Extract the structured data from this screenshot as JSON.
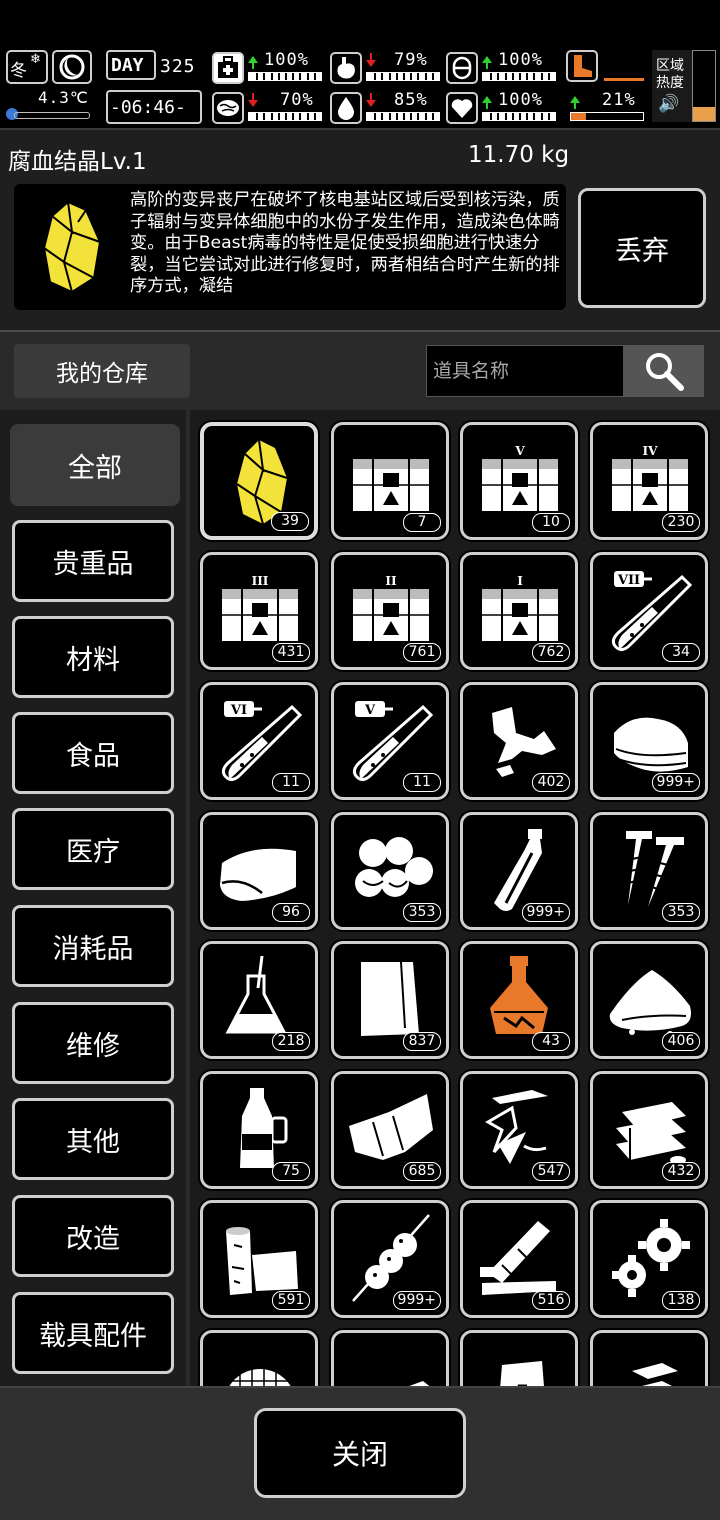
{
  "status": {
    "season": "冬",
    "day_label": "DAY",
    "day": "325",
    "temperature": "4.3℃",
    "clock": "-06:46-",
    "health": "100%",
    "stomach": "79%",
    "stamina": "100%",
    "brain": "70%",
    "water": "85%",
    "mood": "100%",
    "weight_pct": "21%",
    "zone_heat_label": "区域热度"
  },
  "item": {
    "name": "腐血结晶Lv.1",
    "weight": "11.70 kg",
    "description": "高阶的变异丧尸在破坏了核电基站区域后受到核污染，质子辐射与变异体细胞中的水份子发生作用，造成染色体畸变。由于Beast病毒的特性是促使受损细胞进行快速分裂，当它尝试对此进行修复时，两者相结合时产生新的排序方式，凝结"
  },
  "actions": {
    "discard": "丢弃",
    "close": "关闭",
    "warehouse": "我的仓库"
  },
  "search": {
    "placeholder": "道具名称",
    "value": ""
  },
  "categories": [
    "全部",
    "贵重品",
    "材料",
    "食品",
    "医疗",
    "消耗品",
    "维修",
    "其他",
    "改造",
    "载具配件"
  ],
  "inventory": [
    {
      "icon": "crystal-icon",
      "qty": "39"
    },
    {
      "icon": "supply-crate-icon",
      "qty": "7"
    },
    {
      "icon": "supply-crate-v-icon",
      "qty": "10"
    },
    {
      "icon": "supply-crate-iv-icon",
      "qty": "230"
    },
    {
      "icon": "supply-crate-iii-icon",
      "qty": "431"
    },
    {
      "icon": "supply-crate-ii-icon",
      "qty": "761"
    },
    {
      "icon": "supply-crate-i-icon",
      "qty": "762"
    },
    {
      "icon": "test-tube-vii-icon",
      "qty": "34"
    },
    {
      "icon": "test-tube-vi-icon",
      "qty": "11"
    },
    {
      "icon": "test-tube-v-icon",
      "qty": "11"
    },
    {
      "icon": "rags-icon",
      "qty": "402"
    },
    {
      "icon": "cloth-stack-icon",
      "qty": "999+"
    },
    {
      "icon": "towel-icon",
      "qty": "96"
    },
    {
      "icon": "cotton-balls-icon",
      "qty": "353"
    },
    {
      "icon": "bottle-icon",
      "qty": "999+"
    },
    {
      "icon": "screws-icon",
      "qty": "353"
    },
    {
      "icon": "flask-icon",
      "qty": "218"
    },
    {
      "icon": "paper-icon",
      "qty": "837"
    },
    {
      "icon": "potion-icon",
      "qty": "43"
    },
    {
      "icon": "powder-pile-icon",
      "qty": "406"
    },
    {
      "icon": "plastic-bottle-icon",
      "qty": "75"
    },
    {
      "icon": "fabric-roll-icon",
      "qty": "685"
    },
    {
      "icon": "glass-shards-icon",
      "qty": "547"
    },
    {
      "icon": "plates-icon",
      "qty": "432"
    },
    {
      "icon": "wood-blocks-icon",
      "qty": "591"
    },
    {
      "icon": "meat-skewer-icon",
      "qty": "999+"
    },
    {
      "icon": "planks-icon",
      "qty": "516"
    },
    {
      "icon": "gears-icon",
      "qty": "138"
    },
    {
      "icon": "mesh-filter-icon",
      "qty": ""
    },
    {
      "icon": "metal-bar-icon",
      "qty": ""
    },
    {
      "icon": "sack-icon",
      "qty": ""
    },
    {
      "icon": "ingots-icon",
      "qty": ""
    }
  ],
  "colors": {
    "accent_orange": "#e8792a",
    "up_green": "#2fd22f",
    "down_red": "#e02020",
    "crystal_yellow": "#f2e23a"
  }
}
